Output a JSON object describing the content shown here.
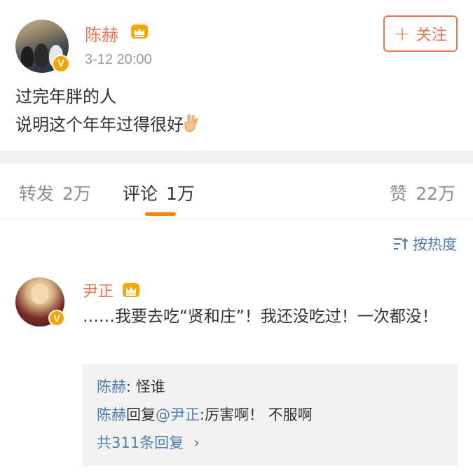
{
  "post": {
    "username": "陈赫",
    "timestamp": "3-12 20:00",
    "follow_label": "关注",
    "text_lines": [
      "过完年胖的人",
      "说明这个年年过得很好"
    ],
    "verified_badge": "V",
    "icons": [
      "crown-icon",
      "verified-icon",
      "plus-icon",
      "rock-hand-emoji-icon"
    ]
  },
  "tabs": {
    "repost": {
      "label": "转发",
      "count": "2万"
    },
    "comments": {
      "label": "评论",
      "count": "1万"
    },
    "likes": {
      "label": "赞",
      "count": "22万"
    },
    "active": "comments"
  },
  "sort": {
    "label": "按热度",
    "icon": "sort-icon"
  },
  "comment": {
    "username": "尹正",
    "verified_badge": "V",
    "text": "……我要去吃“贤和庄”！我还没吃过！一次都没！",
    "replies": [
      {
        "name": "陈赫",
        "text": ": 怪谁"
      },
      {
        "name": "陈赫",
        "middle": "回复",
        "mention": "@尹正",
        "text": ":厉害啊！ 不服啊"
      }
    ],
    "more_label": "共311条回复"
  },
  "colors": {
    "accent_orange": "#eb7350",
    "tab_indicator": "#ff8200",
    "link_blue": "#4f7cae",
    "badge_gold": "#f7a500",
    "gap_gray": "#f2f2f2"
  }
}
